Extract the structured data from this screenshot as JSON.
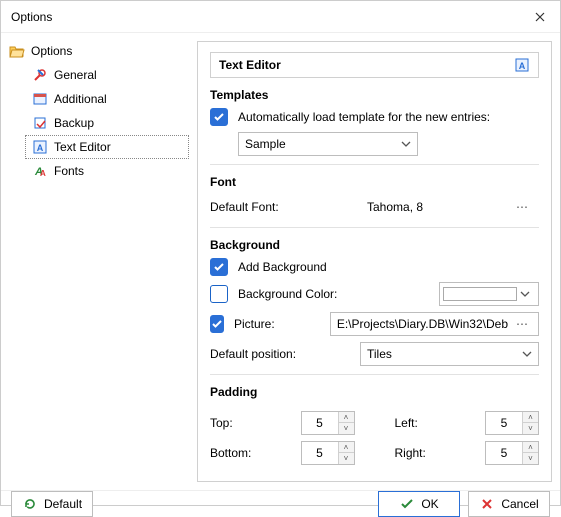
{
  "window": {
    "title": "Options"
  },
  "tree": {
    "root": "Options",
    "items": [
      {
        "label": "General"
      },
      {
        "label": "Additional"
      },
      {
        "label": "Backup"
      },
      {
        "label": "Text Editor",
        "selected": true
      },
      {
        "label": "Fonts"
      }
    ]
  },
  "panel": {
    "title": "Text Editor",
    "templates": {
      "heading": "Templates",
      "auto_load_label": "Automatically load template for the new entries:",
      "auto_load_checked": true,
      "template_value": "Sample"
    },
    "font": {
      "heading": "Font",
      "default_label": "Default Font:",
      "value": "Tahoma, 8"
    },
    "background": {
      "heading": "Background",
      "add_bg_label": "Add Background",
      "add_bg_checked": true,
      "color_label": "Background Color:",
      "color_checked": false,
      "color_value": "#ffffff",
      "picture_label": "Picture:",
      "picture_checked": true,
      "picture_path": "E:\\Projects\\Diary.DB\\Win32\\Deb",
      "position_label": "Default position:",
      "position_value": "Tiles"
    },
    "padding": {
      "heading": "Padding",
      "top_label": "Top:",
      "top": "5",
      "bottom_label": "Bottom:",
      "bottom": "5",
      "left_label": "Left:",
      "left": "5",
      "right_label": "Right:",
      "right": "5"
    }
  },
  "footer": {
    "default": "Default",
    "ok": "OK",
    "cancel": "Cancel"
  }
}
